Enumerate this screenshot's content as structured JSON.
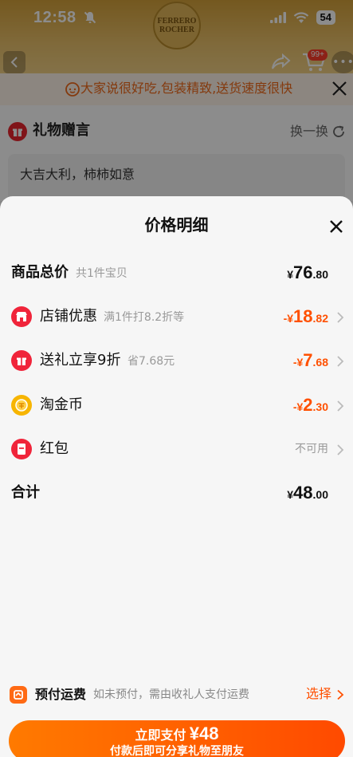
{
  "status_bar": {
    "time": "12:58",
    "battery": "54"
  },
  "header": {
    "logo_line1": "FERRERO",
    "logo_line2": "ROCHER",
    "cart_badge": "99+"
  },
  "review_banner": {
    "text": "大家说很好吃,包装精致,送货速度很快"
  },
  "gift_section": {
    "title": "礼物赠言",
    "swap_label": "换一换",
    "message": "大吉大利，柿柿如意"
  },
  "sheet": {
    "title": "价格明细",
    "rows": {
      "total_goods": {
        "label": "商品总价",
        "sub": "共1件宝贝",
        "sym": "¥",
        "int": "76",
        "dec": ".80"
      },
      "store_discount": {
        "label": "店铺优惠",
        "sub": "满1件打8.2折等",
        "sym": "-¥",
        "int": "18",
        "dec": ".82"
      },
      "gift_discount": {
        "label": "送礼立享9折",
        "sub": "省7.68元",
        "sym": "-¥",
        "int": "7",
        "dec": ".68"
      },
      "taojinbi": {
        "label": "淘金币",
        "sym": "-¥",
        "int": "2",
        "dec": ".30"
      },
      "red_packet": {
        "label": "红包",
        "status": "不可用"
      },
      "sum": {
        "label": "合计",
        "sym": "¥",
        "int": "48",
        "dec": ".00"
      }
    },
    "shipping": {
      "label": "预付运费",
      "desc": "如未预付，需由收礼人支付运费",
      "select": "选择"
    },
    "pay_button": {
      "label": "立即支付",
      "amount": "¥48",
      "sub": "付款后即可分享礼物至朋友"
    }
  },
  "colors": {
    "accent_orange": "#ff5000",
    "discount_red": "#ff5000",
    "pay_gradient_start": "#ff7a00",
    "pay_gradient_end": "#ff4a00"
  }
}
